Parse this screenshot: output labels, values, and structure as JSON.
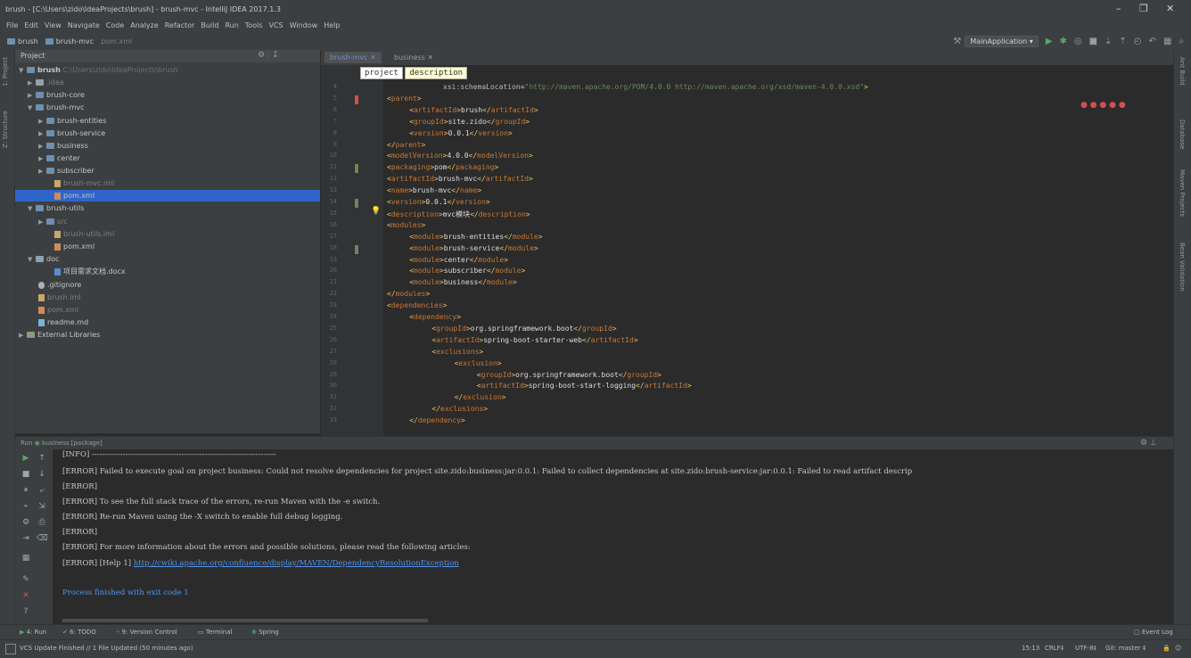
{
  "window": {
    "title": "brush - [C:\\Users\\zido\\IdeaProjects\\brush] - brush-mvc - IntelliJ IDEA 2017.1.3",
    "minimize": "–",
    "maximize": "❐",
    "close": "✕"
  },
  "menu": [
    "File",
    "Edit",
    "View",
    "Navigate",
    "Code",
    "Analyze",
    "Refactor",
    "Build",
    "Run",
    "Tools",
    "VCS",
    "Window",
    "Help"
  ],
  "nav": {
    "crumbs": [
      "brush",
      "brush-mvc",
      "pom.xml"
    ],
    "run_config": "MainApplication ▾"
  },
  "left_stripe": [
    "1: Project",
    "Z: Structure"
  ],
  "project_panel": {
    "title": "Project",
    "items": [
      {
        "label": "brush",
        "path": "C:\\Users\\zido\\IdeaProjects\\brush"
      },
      {
        "label": ".idea"
      },
      {
        "label": "brush-core"
      },
      {
        "label": "brush-mvc"
      },
      {
        "label": "brush-entities"
      },
      {
        "label": "brush-service"
      },
      {
        "label": "business"
      },
      {
        "label": "center"
      },
      {
        "label": "subscriber"
      },
      {
        "label": "brush-mvc.iml"
      },
      {
        "label": "pom.xml"
      },
      {
        "label": "brush-utils"
      },
      {
        "label": "src"
      },
      {
        "label": "brush-utils.iml"
      },
      {
        "label": "pom.xml"
      },
      {
        "label": "doc"
      },
      {
        "label": "项目需求文档.docx"
      },
      {
        "label": ".gitignore"
      },
      {
        "label": "brush.iml"
      },
      {
        "label": "pom.xml"
      },
      {
        "label": "readme.md"
      },
      {
        "label": "External Libraries"
      }
    ]
  },
  "editor": {
    "tabs": [
      "brush-mvc",
      "business"
    ],
    "breadcrumb": [
      "project",
      "description"
    ],
    "lines": [
      {
        "n": "4",
        "a": "",
        "t": "xsi:schemaLocation",
        "c": "=",
        "s": "\"http://maven.apache.org/POM/4.0.0 http://maven.apache.org/xsd/maven-4.0.0.xsd\"",
        "e": ">"
      },
      {
        "n": "5",
        "o": "<",
        "t": "parent",
        "c": ">"
      },
      {
        "n": "6",
        "o": "<",
        "t": "artifactId",
        "c": ">",
        "v": "brush",
        "x": "</",
        "t2": "artifactId",
        "e": ">"
      },
      {
        "n": "7",
        "o": "<",
        "t": "groupId",
        "c": ">",
        "v": "site.zido",
        "x": "</",
        "t2": "groupId",
        "e": ">"
      },
      {
        "n": "8",
        "o": "<",
        "t": "version",
        "c": ">",
        "v": "0.0.1",
        "x": "</",
        "t2": "version",
        "e": ">"
      },
      {
        "n": "9",
        "o": "</",
        "t": "parent",
        "c": ">"
      },
      {
        "n": "10",
        "o": "<",
        "t": "modelVersion",
        "c": ">",
        "v": "4.0.0",
        "x": "</",
        "t2": "modelVersion",
        "e": ">"
      },
      {
        "n": "11",
        "o": "<",
        "t": "packaging",
        "c": ">",
        "v": "pom",
        "x": "</",
        "t2": "packaging",
        "e": ">"
      },
      {
        "n": "12",
        "o": "<",
        "t": "artifactId",
        "c": ">",
        "v": "brush-mvc",
        "x": "</",
        "t2": "artifactId",
        "e": ">"
      },
      {
        "n": "13",
        "o": "<",
        "t": "name",
        "c": ">",
        "v": "brush-mvc",
        "x": "</",
        "t2": "name",
        "e": ">"
      },
      {
        "n": "14",
        "o": "<",
        "t": "version",
        "c": ">",
        "v": "0.0.1",
        "x": "</",
        "t2": "version",
        "e": ">"
      },
      {
        "n": "15",
        "o": "<",
        "t": "description",
        "c": ">",
        "v": "mvc模块",
        "x": "</",
        "t2": "description",
        "e": ">"
      },
      {
        "n": "16",
        "o": "<",
        "t": "modules",
        "c": ">"
      },
      {
        "n": "17",
        "o": "<",
        "t": "module",
        "c": ">",
        "v": "brush-entities",
        "x": "</",
        "t2": "module",
        "e": ">"
      },
      {
        "n": "18",
        "o": "<",
        "t": "module",
        "c": ">",
        "v": "brush-service",
        "x": "</",
        "t2": "module",
        "e": ">"
      },
      {
        "n": "19",
        "o": "<",
        "t": "module",
        "c": ">",
        "v": "center",
        "x": "</",
        "t2": "module",
        "e": ">"
      },
      {
        "n": "20",
        "o": "<",
        "t": "module",
        "c": ">",
        "v": "subscriber",
        "x": "</",
        "t2": "module",
        "e": ">"
      },
      {
        "n": "21",
        "o": "<",
        "t": "module",
        "c": ">",
        "v": "business",
        "x": "</",
        "t2": "module",
        "e": ">"
      },
      {
        "n": "22",
        "o": "</",
        "t": "modules",
        "c": ">"
      },
      {
        "n": "23",
        "o": "<",
        "t": "dependencies",
        "c": ">"
      },
      {
        "n": "24",
        "o": "<",
        "t": "dependency",
        "c": ">"
      },
      {
        "n": "25",
        "o": "<",
        "t": "groupId",
        "c": ">",
        "v": "org.springframework.boot",
        "x": "</",
        "t2": "groupId",
        "e": ">"
      },
      {
        "n": "26",
        "o": "<",
        "t": "artifactId",
        "c": ">",
        "v": "spring-boot-starter-web",
        "x": "</",
        "t2": "artifactId",
        "e": ">"
      },
      {
        "n": "27",
        "o": "<",
        "t": "exclusions",
        "c": ">"
      },
      {
        "n": "28",
        "o": "<",
        "t": "exclusion",
        "c": ">"
      },
      {
        "n": "29",
        "o": "<",
        "t": "groupId",
        "c": ">",
        "v": "org.springframework.boot",
        "x": "</",
        "t2": "groupId",
        "e": ">"
      },
      {
        "n": "30",
        "o": "<",
        "t": "artifactId",
        "c": ">",
        "v": "spring-boot-start-logging",
        "x": "</",
        "t2": "artifactId",
        "e": ">"
      },
      {
        "n": "31",
        "o": "</",
        "t": "exclusion",
        "c": ">"
      },
      {
        "n": "32",
        "o": "</",
        "t": "exclusions",
        "c": ">"
      },
      {
        "n": "33",
        "o": "</",
        "t": "dependency",
        "c": ">"
      }
    ]
  },
  "right_stripe": [
    "Ant Build",
    "Database",
    "Maven Projects",
    "Bean Validation"
  ],
  "run_panel": {
    "title": "Run",
    "config": "business [package]",
    "console": [
      "[INFO] ------------------------------------------------------------------------",
      "[ERROR] Failed to execute goal on project business: Could not resolve dependencies for project site.zido:business:jar:0.0.1: Failed to collect dependencies at site.zido:brush-service:jar:0.0.1: Failed to read artifact descrip",
      "[ERROR]",
      "[ERROR] To see the full stack trace of the errors, re-run Maven with the -e switch.",
      "[ERROR] Re-run Maven using the -X switch to enable full debug logging.",
      "[ERROR]",
      "[ERROR] For more information about the errors and possible solutions, please read the following articles:"
    ],
    "help_prefix": "[ERROR] [Help 1] ",
    "help_link": "http://cwiki.apache.org/confluence/display/MAVEN/DependencyResolutionException",
    "exit_message": "Process finished with exit code 1"
  },
  "bottom_tabs": [
    "4: Run",
    "6: TODO",
    "9: Version Control",
    "Terminal",
    "Spring"
  ],
  "event_log": "Event Log",
  "status": {
    "message": "VCS Update Finished // 1 File Updated (50 minutes ago)",
    "position": "15:13",
    "line_sep": "CRLF‡",
    "encoding": "UTF-8‡",
    "git": "Git: master ‡"
  },
  "colors": {
    "accent": "#2f65ca",
    "error_link": "#5394ec",
    "tag": "#e8bf6a"
  }
}
